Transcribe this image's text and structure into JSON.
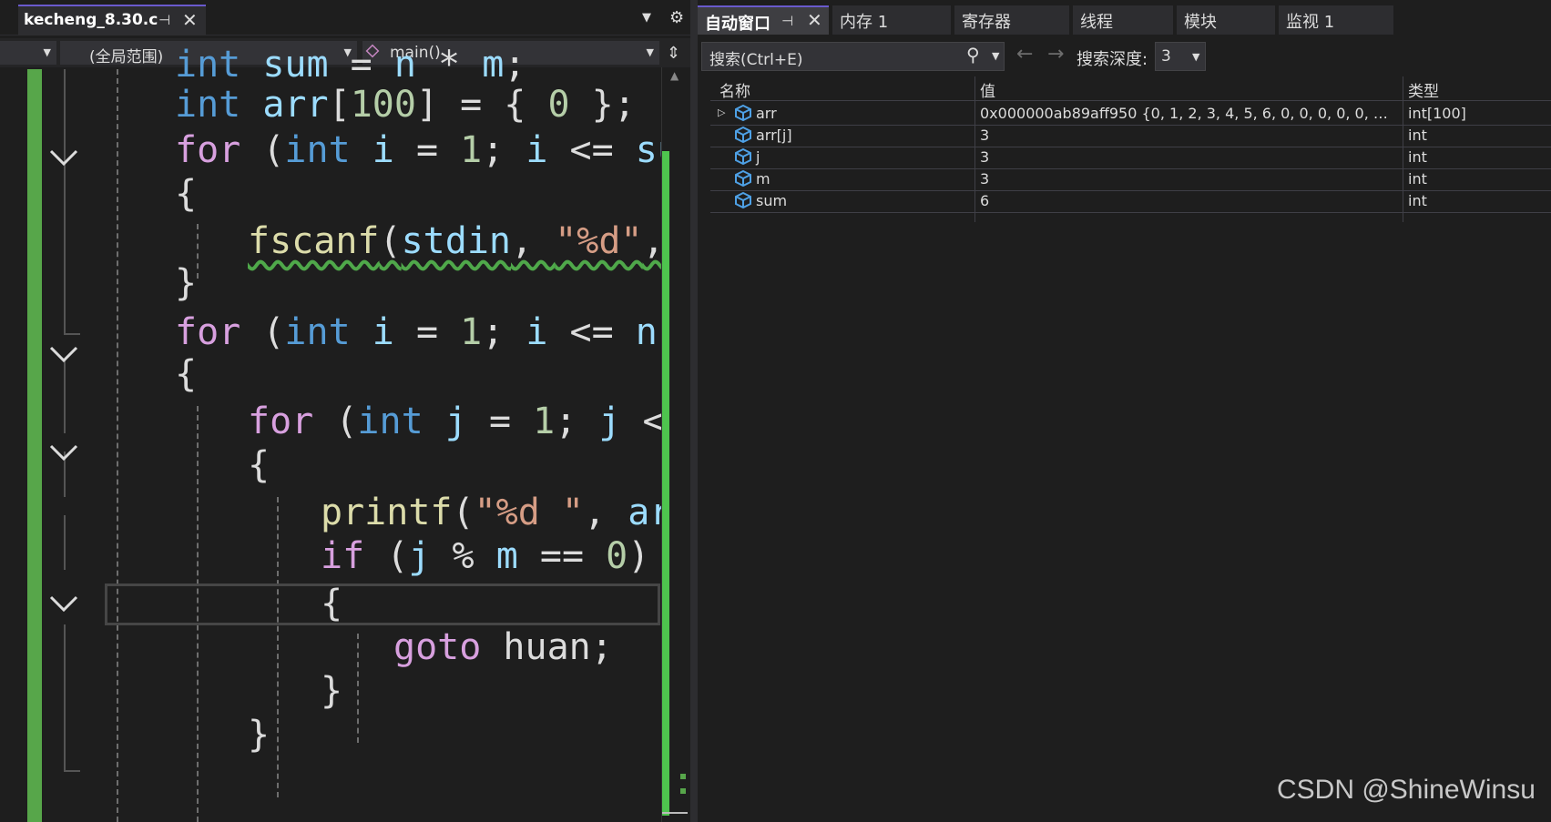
{
  "editor": {
    "tab": {
      "filename": "kecheng_8.30.c",
      "pin_glyph": "⊣",
      "close_glyph": "✕"
    },
    "nav": {
      "scope_label": "(全局范围)",
      "function_label": "main()"
    },
    "code_lines": [
      {
        "tokens": [
          {
            "t": "int",
            "c": "kw-b"
          },
          {
            "t": " ",
            "c": "pun"
          },
          {
            "t": "sum",
            "c": "var"
          },
          {
            "t": " = ",
            "c": "pun"
          },
          {
            "t": "n",
            "c": "var"
          },
          {
            "t": " * ",
            "c": "pun"
          },
          {
            "t": "m",
            "c": "var"
          },
          {
            "t": ";",
            "c": "pun"
          }
        ]
      },
      {
        "tokens": [
          {
            "t": "int",
            "c": "kw-b"
          },
          {
            "t": " ",
            "c": "pun"
          },
          {
            "t": "arr",
            "c": "var"
          },
          {
            "t": "[",
            "c": "pun"
          },
          {
            "t": "100",
            "c": "num"
          },
          {
            "t": "] = { ",
            "c": "pun"
          },
          {
            "t": "0",
            "c": "num"
          },
          {
            "t": " };",
            "c": "pun"
          }
        ]
      },
      {
        "tokens": [
          {
            "t": "for",
            "c": "kw-p"
          },
          {
            "t": " (",
            "c": "pun"
          },
          {
            "t": "int",
            "c": "kw-b"
          },
          {
            "t": " ",
            "c": "pun"
          },
          {
            "t": "i",
            "c": "var"
          },
          {
            "t": " = ",
            "c": "pun"
          },
          {
            "t": "1",
            "c": "num"
          },
          {
            "t": "; ",
            "c": "pun"
          },
          {
            "t": "i",
            "c": "var"
          },
          {
            "t": " <= ",
            "c": "pun"
          },
          {
            "t": "sum",
            "c": "var"
          }
        ]
      },
      {
        "tokens": [
          {
            "t": "{",
            "c": "pun"
          }
        ]
      },
      {
        "tokens": [
          {
            "t": "fscanf",
            "c": "fn squig"
          },
          {
            "t": "(",
            "c": "pun squig"
          },
          {
            "t": "stdin",
            "c": "var squig"
          },
          {
            "t": ", ",
            "c": "pun squig"
          },
          {
            "t": "\"%d\"",
            "c": "str squig"
          },
          {
            "t": ",",
            "c": "pun squig"
          }
        ]
      },
      {
        "tokens": [
          {
            "t": "}",
            "c": "pun"
          }
        ]
      },
      {
        "tokens": [
          {
            "t": "for",
            "c": "kw-p"
          },
          {
            "t": " (",
            "c": "pun"
          },
          {
            "t": "int",
            "c": "kw-b"
          },
          {
            "t": " ",
            "c": "pun"
          },
          {
            "t": "i",
            "c": "var"
          },
          {
            "t": " = ",
            "c": "pun"
          },
          {
            "t": "1",
            "c": "num"
          },
          {
            "t": "; ",
            "c": "pun"
          },
          {
            "t": "i",
            "c": "var"
          },
          {
            "t": " <= ",
            "c": "pun"
          },
          {
            "t": "n",
            "c": "var"
          },
          {
            "t": ";",
            "c": "pun"
          }
        ]
      },
      {
        "tokens": [
          {
            "t": "{",
            "c": "pun"
          }
        ]
      },
      {
        "tokens": [
          {
            "t": "for",
            "c": "kw-p"
          },
          {
            "t": " (",
            "c": "pun"
          },
          {
            "t": "int",
            "c": "kw-b"
          },
          {
            "t": " ",
            "c": "pun"
          },
          {
            "t": "j",
            "c": "var"
          },
          {
            "t": " = ",
            "c": "pun"
          },
          {
            "t": "1",
            "c": "num"
          },
          {
            "t": "; ",
            "c": "pun"
          },
          {
            "t": "j",
            "c": "var"
          },
          {
            "t": " <=",
            "c": "pun"
          }
        ]
      },
      {
        "tokens": [
          {
            "t": "{",
            "c": "pun"
          }
        ]
      },
      {
        "tokens": [
          {
            "t": "printf",
            "c": "fn"
          },
          {
            "t": "(",
            "c": "pun"
          },
          {
            "t": "\"%d \"",
            "c": "str"
          },
          {
            "t": ", ",
            "c": "pun"
          },
          {
            "t": "ar",
            "c": "var"
          }
        ]
      },
      {
        "tokens": [
          {
            "t": "if",
            "c": "kw-p"
          },
          {
            "t": " (",
            "c": "pun"
          },
          {
            "t": "j",
            "c": "var"
          },
          {
            "t": " % ",
            "c": "pun"
          },
          {
            "t": "m",
            "c": "var"
          },
          {
            "t": " == ",
            "c": "pun"
          },
          {
            "t": "0",
            "c": "num"
          },
          {
            "t": ")",
            "c": "pun"
          }
        ]
      },
      {
        "tokens": [
          {
            "t": "{",
            "c": "pun"
          }
        ]
      },
      {
        "tokens": [
          {
            "t": "goto",
            "c": "kw-p"
          },
          {
            "t": " huan;",
            "c": "pun"
          }
        ]
      },
      {
        "tokens": [
          {
            "t": "}",
            "c": "pun"
          }
        ]
      },
      {
        "tokens": [
          {
            "t": "}",
            "c": "pun"
          }
        ]
      }
    ]
  },
  "autos_panel": {
    "tabs": [
      {
        "label": "自动窗口",
        "active": true
      },
      {
        "label": "内存 1",
        "active": false
      },
      {
        "label": "寄存器",
        "active": false
      },
      {
        "label": "线程",
        "active": false
      },
      {
        "label": "模块",
        "active": false
      },
      {
        "label": "监视 1",
        "active": false
      }
    ],
    "search_placeholder": "搜索(Ctrl+E)",
    "depth_label": "搜索深度:",
    "depth_value": "3",
    "columns": {
      "name": "名称",
      "value": "值",
      "type": "类型"
    },
    "rows": [
      {
        "name": "arr",
        "value": "0x000000ab89aff950 {0, 1, 2, 3, 4, 5, 6, 0, 0, 0, 0, 0, 0, 0, ...",
        "type": "int[100]",
        "expandable": true
      },
      {
        "name": "arr[j]",
        "value": "3",
        "type": "int",
        "expandable": false
      },
      {
        "name": "j",
        "value": "3",
        "type": "int",
        "expandable": false
      },
      {
        "name": "m",
        "value": "3",
        "type": "int",
        "expandable": false
      },
      {
        "name": "sum",
        "value": "6",
        "type": "int",
        "expandable": false
      }
    ]
  },
  "watermark": "CSDN @ShineWinsu",
  "colors": {
    "accent_purple": "#6a5acd",
    "change_bar_green": "#57a64a",
    "keyword_blue": "#569cd6",
    "keyword_purple": "#d8a0df",
    "variable": "#9cdcfe",
    "function": "#dcdcaa",
    "string": "#d69d85",
    "number": "#b5cea8"
  }
}
